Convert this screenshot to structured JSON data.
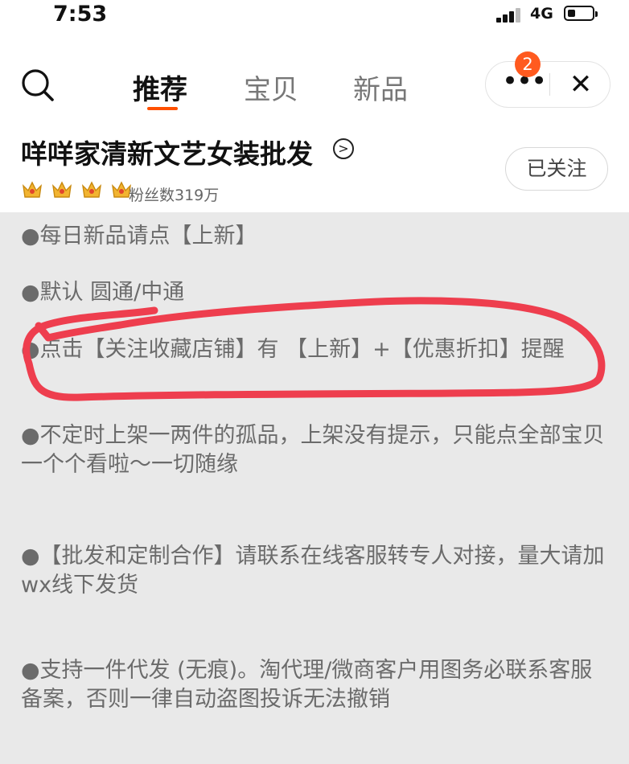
{
  "status_bar": {
    "time": "7:53",
    "network": "4G"
  },
  "nav": {
    "tabs": [
      {
        "label": "推荐",
        "active": true
      },
      {
        "label": "宝贝",
        "active": false
      },
      {
        "label": "新品",
        "active": false
      }
    ],
    "more_badge": "2",
    "accent_color": "#ff5000"
  },
  "shop": {
    "name": "咩咩家清新文艺女装批发",
    "fans": "粉丝数319万",
    "follow_label": "已关注",
    "crown_count": 4
  },
  "notices": [
    "●每日新品请点【上新】",
    "●默认 圆通/中通",
    "●点击【关注收藏店铺】有 【上新】+【优惠折扣】提醒",
    "●不定时上架一两件的孤品，上架没有提示，只能点全部宝贝一个个看啦～一切随缘",
    "●【批发和定制合作】请联系在线客服转专人对接，量大请加wx线下发货",
    "●支持一件代发 (无痕)。淘代理/微商客户用图务必联系客服备案，否则一律自动盗图投诉无法撤销"
  ],
  "annotation_color": "#ee3e4e"
}
